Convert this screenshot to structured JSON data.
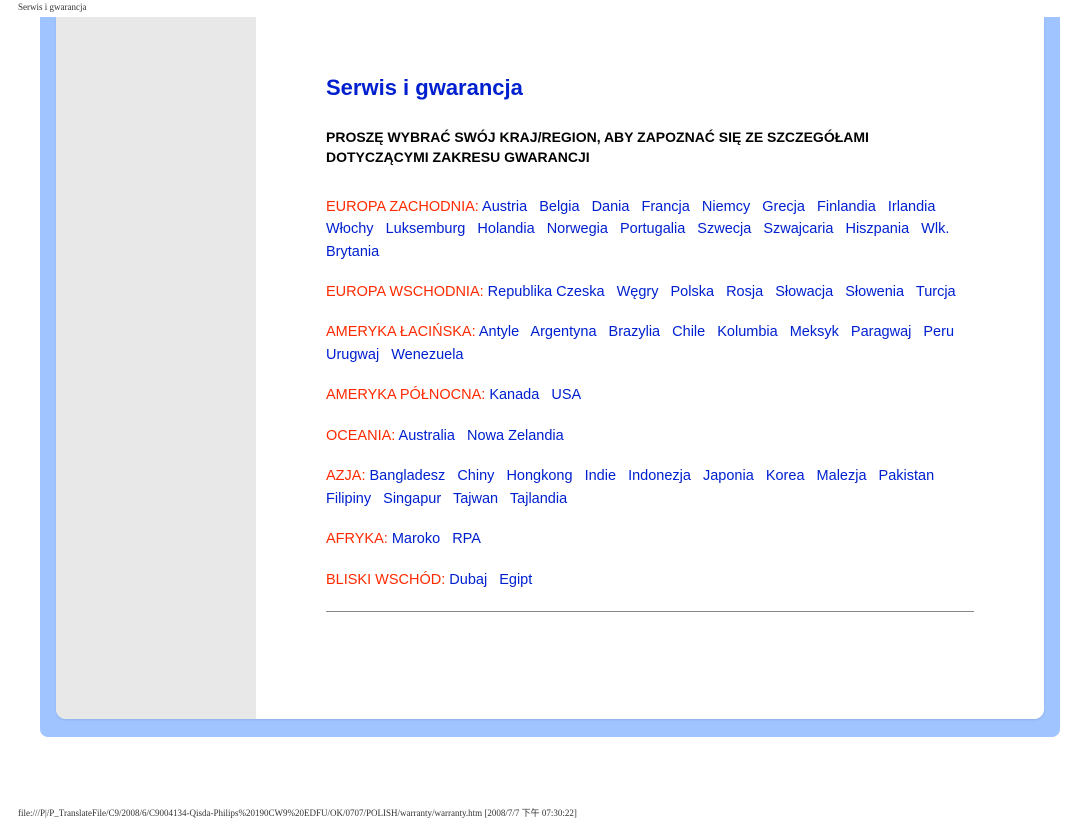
{
  "topLabel": "Serwis i gwarancja",
  "pageTitle": "Serwis i gwarancja",
  "intro": "PROSZĘ WYBRAĆ SWÓJ KRAJ/REGION, ABY ZAPOZNAĆ SIĘ ZE SZCZEGÓŁAMI DOTYCZĄCYMI ZAKRESU GWARANCJI",
  "regions": [
    {
      "label": "EUROPA ZACHODNIA:",
      "countries": [
        "Austria",
        "Belgia",
        "Dania",
        "Francja",
        "Niemcy",
        "Grecja",
        "Finlandia",
        "Irlandia",
        "Włochy",
        "Luksemburg",
        "Holandia",
        "Norwegia",
        "Portugalia",
        "Szwecja",
        "Szwajcaria",
        "Hiszpania",
        "Wlk. Brytania"
      ]
    },
    {
      "label": "EUROPA WSCHODNIA:",
      "countries": [
        "Republika Czeska",
        "Węgry",
        "Polska",
        "Rosja",
        "Słowacja",
        "Słowenia",
        "Turcja"
      ]
    },
    {
      "label": "AMERYKA ŁACIŃSKA:",
      "countries": [
        "Antyle",
        "Argentyna",
        "Brazylia",
        "Chile",
        "Kolumbia",
        "Meksyk",
        "Paragwaj",
        "Peru",
        "Urugwaj",
        "Wenezuela"
      ]
    },
    {
      "label": "AMERYKA PÓŁNOCNA:",
      "countries": [
        "Kanada",
        "USA"
      ]
    },
    {
      "label": "OCEANIA:",
      "countries": [
        "Australia",
        "Nowa Zelandia"
      ]
    },
    {
      "label": "AZJA:",
      "countries": [
        "Bangladesz",
        "Chiny",
        "Hongkong",
        "Indie",
        "Indonezja",
        "Japonia",
        "Korea",
        "Malezja",
        "Pakistan",
        "Filipiny",
        "Singapur",
        "Tajwan",
        "Tajlandia"
      ]
    },
    {
      "label": "AFRYKA:",
      "countries": [
        "Maroko",
        "RPA"
      ]
    },
    {
      "label": "BLISKI WSCHÓD:",
      "countries": [
        "Dubaj",
        "Egipt"
      ]
    }
  ],
  "footerPath": "file:///P|/P_TranslateFile/C9/2008/6/C9004134-Qisda-Philips%20190CW9%20EDFU/OK/0707/POLISH/warranty/warranty.htm [2008/7/7 下午 07:30:22]"
}
